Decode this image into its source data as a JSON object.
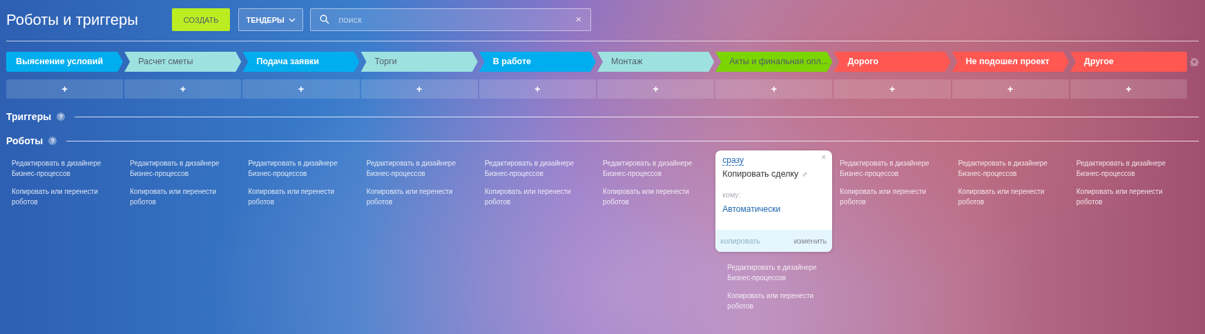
{
  "title": "Роботы и триггеры",
  "create_button": "СОЗДАТЬ",
  "category_dropdown": "ТЕНДЕРЫ",
  "search": {
    "placeholder": "поиск",
    "clear": "×"
  },
  "stages": [
    {
      "name": "Выяснение условий",
      "color": "#00aeef",
      "add_label": "+",
      "edit_link": "Редактировать в дизайнере Бизнес-процессов",
      "copy_link": "Копировать или перенести роботов"
    },
    {
      "name": "Расчет сметы",
      "color": "#9de2e0",
      "add_label": "+",
      "edit_link": "Редактировать в дизайнере Бизнес-процессов",
      "copy_link": "Копировать или перенести роботов"
    },
    {
      "name": "Подача заявки",
      "color": "#00aeef",
      "add_label": "+",
      "edit_link": "Редактировать в дизайнере Бизнес-процессов",
      "copy_link": "Копировать или перенести роботов"
    },
    {
      "name": "Торги",
      "color": "#9de2e0",
      "add_label": "+",
      "edit_link": "Редактировать в дизайнере Бизнес-процессов",
      "copy_link": "Копировать или перенести роботов"
    },
    {
      "name": "В работе",
      "color": "#00aeef",
      "add_label": "+",
      "edit_link": "Редактировать в дизайнере Бизнес-процессов",
      "copy_link": "Копировать или перенести роботов"
    },
    {
      "name": "Монтаж",
      "color": "#9de2e0",
      "add_label": "+",
      "edit_link": "Редактировать в дизайнере Бизнес-процессов",
      "copy_link": "Копировать или перенести роботов"
    },
    {
      "name": "Акты и финальная опл...",
      "color": "#7bd500",
      "add_label": "+",
      "robots": [
        {
          "delay": "сразу",
          "title": "Копировать сделку",
          "close": "×",
          "field_label": "кому:",
          "field_value": "Автоматически",
          "copy_button": {
            "label": "копировать",
            "disabled": true
          },
          "edit_button": "изменить"
        }
      ],
      "edit_link": "Редактировать в дизайнере Бизнес-процессов",
      "copy_link": "Копировать или перенести роботов"
    },
    {
      "name": "Дорого",
      "color": "#ff5752",
      "add_label": "+",
      "edit_link": "Редактировать в дизайнере Бизнес-процессов",
      "copy_link": "Копировать или перенести роботов"
    },
    {
      "name": "Не подошел проект",
      "color": "#ff5752",
      "add_label": "+",
      "edit_link": "Редактировать в дизайнере Бизнес-процессов",
      "copy_link": "Копировать или перенести роботов"
    },
    {
      "name": "Другое",
      "color": "#ff5752",
      "add_label": "+",
      "edit_link": "Редактировать в дизайнере Бизнес-процессов",
      "copy_link": "Копировать или перенести роботов"
    }
  ],
  "triggers_section": {
    "title": "Триггеры",
    "help": "?"
  },
  "robots_section": {
    "title": "Роботы",
    "help": "?"
  }
}
